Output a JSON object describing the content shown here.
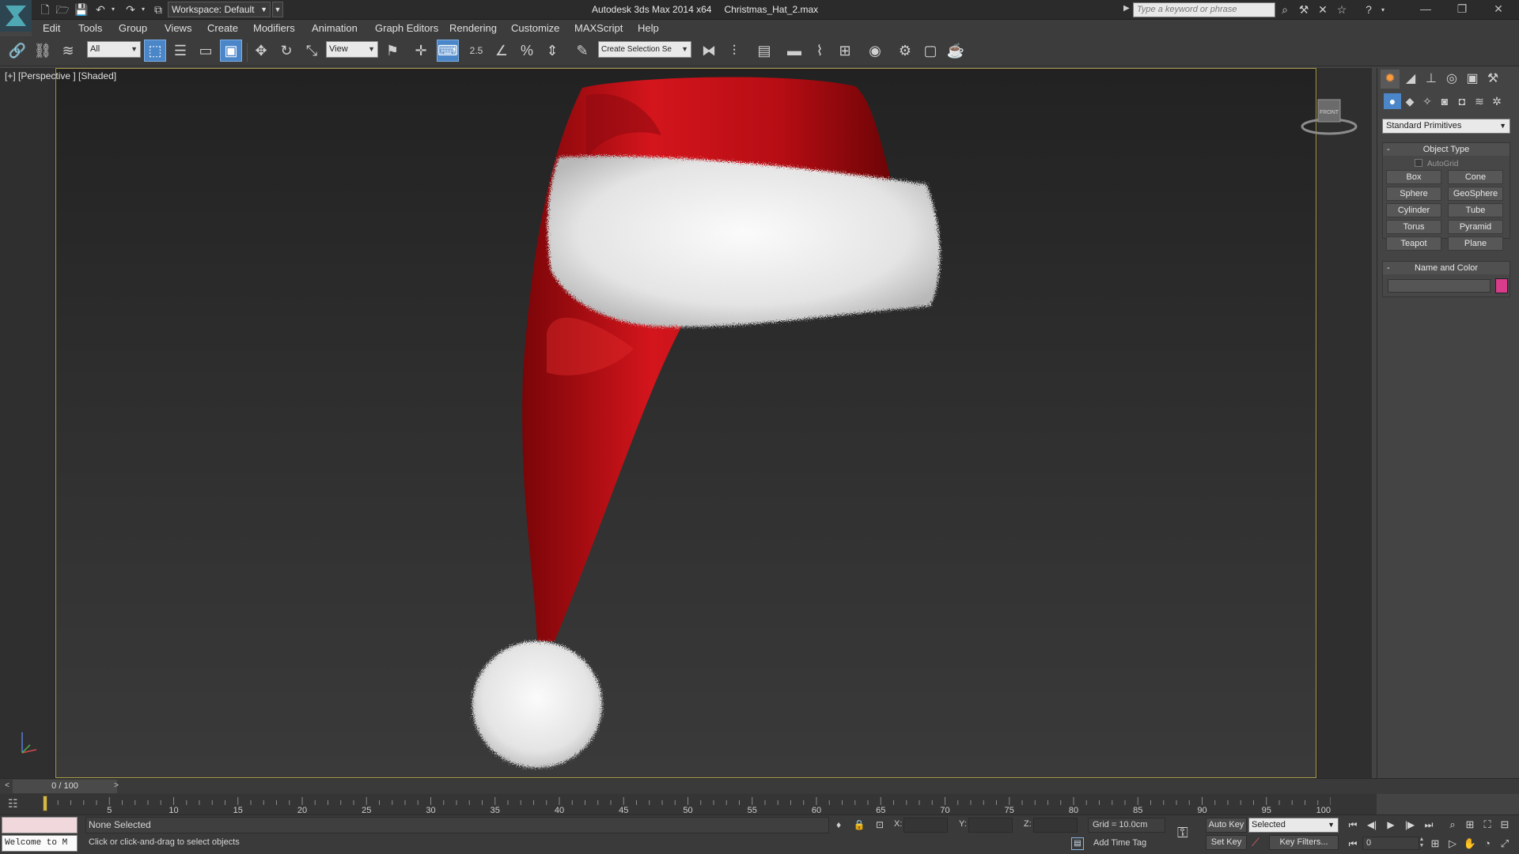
{
  "titlebar": {
    "workspace_label": "Workspace: Default",
    "app_name": "Autodesk 3ds Max  2014 x64",
    "file_name": "Christmas_Hat_2.max",
    "search_placeholder": "Type a keyword or phrase"
  },
  "menu": [
    "Edit",
    "Tools",
    "Group",
    "Views",
    "Create",
    "Modifiers",
    "Animation",
    "Graph Editors",
    "Rendering",
    "Customize",
    "MAXScript",
    "Help"
  ],
  "toolbar": {
    "filter_value": "All",
    "refcoord_value": "View",
    "snap_label": "2.5",
    "selection_set_placeholder": "Create Selection Se"
  },
  "viewport": {
    "label": "[+] [Perspective ] [Shaded]",
    "viewcube_label": "FRONT",
    "colors": {
      "hat_red": "#c8101a",
      "fur_white": "#ececec",
      "accent_border": "#a89a4a"
    }
  },
  "command_panel": {
    "category": "Standard Primitives",
    "object_type_title": "Object Type",
    "autogrid_label": "AutoGrid",
    "object_buttons": [
      "Box",
      "Cone",
      "Sphere",
      "GeoSphere",
      "Cylinder",
      "Tube",
      "Torus",
      "Pyramid",
      "Teapot",
      "Plane"
    ],
    "name_color_title": "Name and Color",
    "object_color": "#d93c8a",
    "rollout_toggle": "-"
  },
  "timeslider": {
    "frame_display": "0 / 100",
    "prev": "<",
    "next": ">"
  },
  "trackbar": {
    "ticks": [
      "5",
      "10",
      "15",
      "20",
      "25",
      "30",
      "35",
      "40",
      "45",
      "50",
      "55",
      "60",
      "65",
      "70",
      "75",
      "80",
      "85",
      "90",
      "95",
      "100"
    ]
  },
  "status": {
    "maxscript_listener": "Welcome to M",
    "selection_status": "None Selected",
    "prompt": "Click or click-and-drag to select objects",
    "x_label": "X:",
    "y_label": "Y:",
    "z_label": "Z:",
    "grid": "Grid = 10.0cm",
    "add_time_tag": "Add Time Tag",
    "auto_key": "Auto Key",
    "set_key": "Set Key",
    "key_mode": "Selected",
    "key_filters": "Key Filters...",
    "current_frame": "0"
  }
}
